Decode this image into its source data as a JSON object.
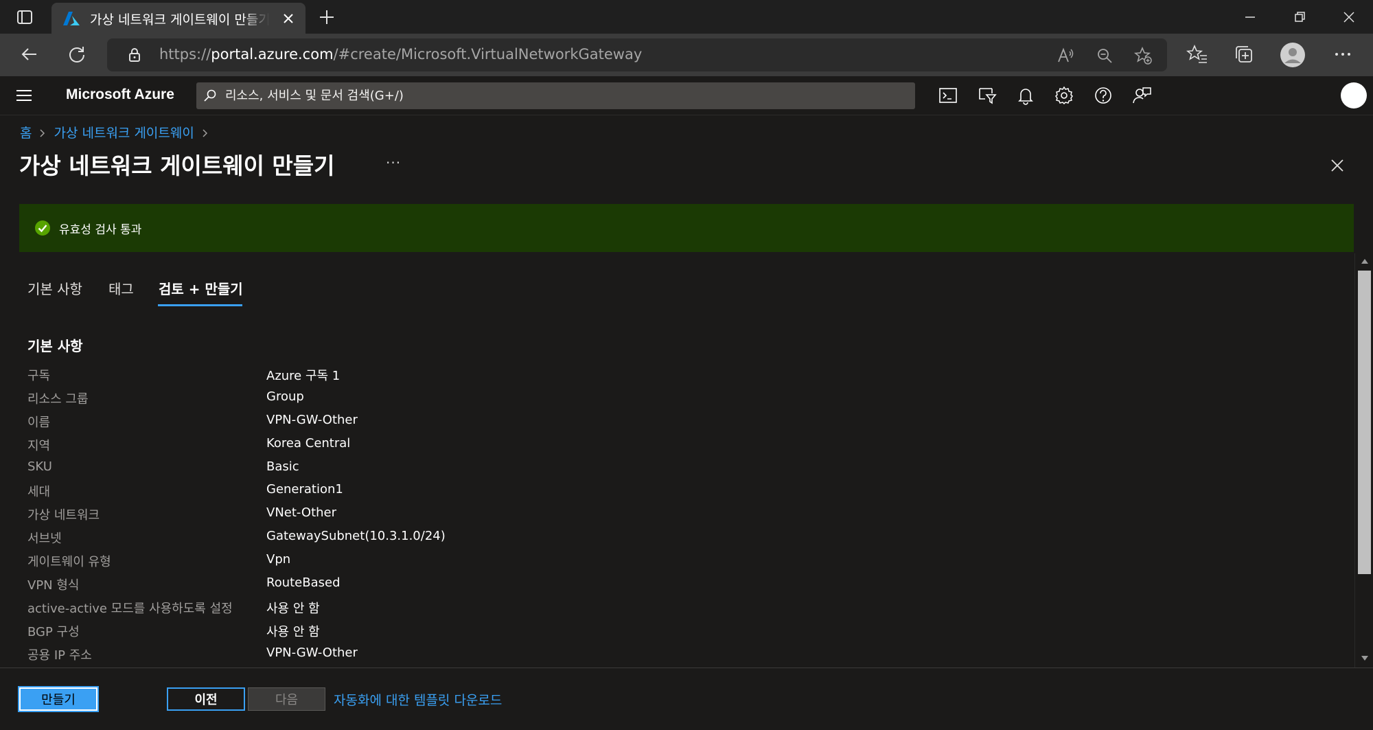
{
  "browser": {
    "tab_title": "가상 네트워크 게이트웨이 만들기 - Microsoft Azure",
    "url_prefix": "https://",
    "url_host": "portal.azure.com",
    "url_path": "/#create/Microsoft.VirtualNetworkGateway"
  },
  "azure_header": {
    "brand": "Microsoft Azure",
    "search_placeholder": "리소스, 서비스 및 문서 검색(G+/)"
  },
  "breadcrumb": {
    "home": "홈",
    "parent": "가상 네트워크 게이트웨이"
  },
  "page": {
    "title": "가상 네트워크 게이트웨이 만들기",
    "more": "···"
  },
  "banner": {
    "text": "유효성 검사 통과",
    "color": "#1b3a04"
  },
  "tabs": [
    {
      "label": "기본 사항",
      "active": false
    },
    {
      "label": "태그",
      "active": false
    },
    {
      "label": "검토 + 만들기",
      "active": true
    }
  ],
  "section": {
    "title": "기본 사항",
    "rows": [
      {
        "label": "구독",
        "value": "Azure 구독 1"
      },
      {
        "label": "리소스 그룹",
        "value": "Group"
      },
      {
        "label": "이름",
        "value": "VPN-GW-Other"
      },
      {
        "label": "지역",
        "value": "Korea Central"
      },
      {
        "label": "SKU",
        "value": "Basic"
      },
      {
        "label": "세대",
        "value": "Generation1"
      },
      {
        "label": "가상 네트워크",
        "value": "VNet-Other"
      },
      {
        "label": "서브넷",
        "value": "GatewaySubnet(10.3.1.0/24)"
      },
      {
        "label": "게이트웨이 유형",
        "value": "Vpn"
      },
      {
        "label": "VPN 형식",
        "value": "RouteBased"
      },
      {
        "label": "active-active 모드를 사용하도록 설정",
        "value": "사용 안 함"
      },
      {
        "label": "BGP 구성",
        "value": "사용 안 함"
      },
      {
        "label": "공용 IP 주소",
        "value": "VPN-GW-Other"
      }
    ]
  },
  "footer": {
    "create": "만들기",
    "previous": "이전",
    "next": "다음",
    "download_link": "자동화에 대한 템플릿 다운로드"
  },
  "colors": {
    "accent": "#3aa0f3",
    "background": "#1b1a19",
    "success": "#57a300"
  }
}
